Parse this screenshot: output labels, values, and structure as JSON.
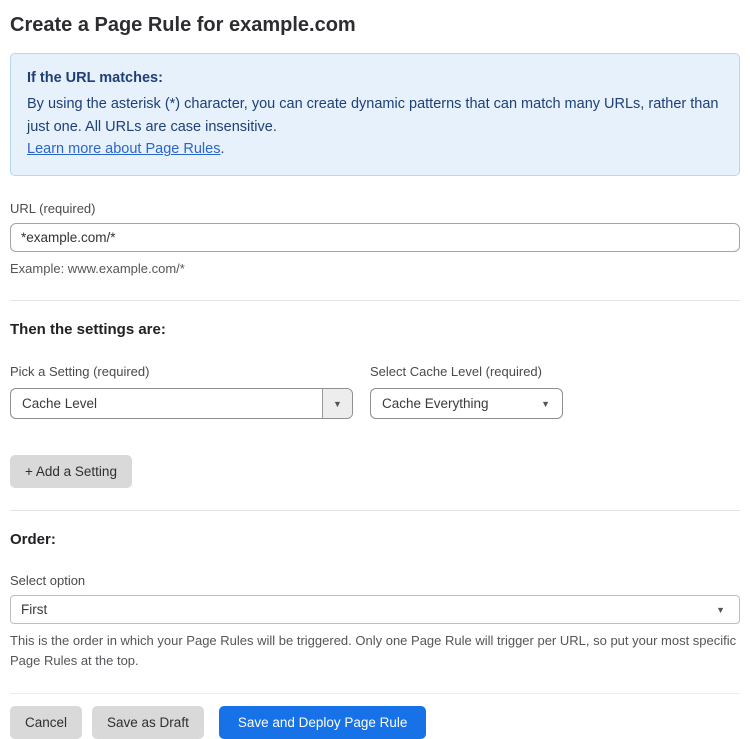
{
  "page": {
    "title": "Create a Page Rule for example.com"
  },
  "info_box": {
    "heading": "If the URL matches:",
    "body": "By using the asterisk (*) character, you can create dynamic patterns that can match many URLs, rather than just one. All URLs are case insensitive.",
    "link_text": "Learn more about Page Rules",
    "link_suffix": "."
  },
  "url_field": {
    "label": "URL (required)",
    "value": "*example.com/*",
    "helper": "Example: www.example.com/*"
  },
  "settings": {
    "heading": "Then the settings are:",
    "pick_setting": {
      "label": "Pick a Setting (required)",
      "value": "Cache Level"
    },
    "cache_level": {
      "label": "Select Cache Level (required)",
      "value": "Cache Everything"
    },
    "add_button_label": "+ Add a Setting"
  },
  "order": {
    "heading": "Order:",
    "label": "Select option",
    "value": "First",
    "helper": "This is the order in which your Page Rules will be triggered. Only one Page Rule will trigger per URL, so put your most specific Page Rules at the top."
  },
  "footer": {
    "cancel_label": "Cancel",
    "save_draft_label": "Save as Draft",
    "deploy_label": "Save and Deploy Page Rule"
  },
  "icons": {
    "dropdown_arrow": "▼"
  },
  "colors": {
    "primary_button": "#1672e6",
    "info_background": "#e6f1fc",
    "info_border": "#b5d7f3",
    "info_text": "#1f3f77",
    "link": "#2b65cc",
    "grey_button": "#d9d9d9"
  }
}
